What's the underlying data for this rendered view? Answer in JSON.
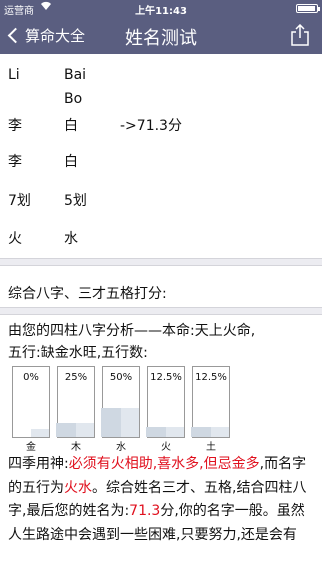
{
  "status": {
    "carrier": "运营商",
    "time": "上午11:43"
  },
  "nav": {
    "back_label": "算命大全",
    "title": "姓名测试"
  },
  "names": {
    "pinyin_first": "Li",
    "pinyin_second_a": "Bai",
    "pinyin_second_b": "Bo",
    "row1_c1": "李",
    "row1_c2": "白",
    "score_text": "->71.3分",
    "row2_c1": "李",
    "row2_c2": "白",
    "strokes_c1": "7划",
    "strokes_c2": "5划",
    "element_c1": "火",
    "element_c2": "水"
  },
  "section_title": "综合八字、三才五格打分:",
  "analysis": {
    "line1": "由您的四柱八字分析——本命:天上火命,",
    "line2": "五行:缺金水旺,五行数:"
  },
  "bars": [
    {
      "element": "金",
      "pct_label": "0%",
      "value": 0
    },
    {
      "element": "木",
      "pct_label": "25%",
      "value": 25
    },
    {
      "element": "水",
      "pct_label": "50%",
      "value": 50
    },
    {
      "element": "火",
      "pct_label": "12.5%",
      "value": 12.5
    },
    {
      "element": "土",
      "pct_label": "12.5%",
      "value": 12.5
    }
  ],
  "paragraph": {
    "p1": "四季用神:",
    "p2": "必须有火相助,喜水多,但忌金多",
    "p3": ",而名字的五行为",
    "p4": "火水",
    "p5": "。综合姓名三才、五格,结合四柱八字,最后您的姓名为:",
    "p6": "71.3",
    "p7": "分,你的名字一般。虽然人生路途中会遇到一些困难,只要努力,还是会有"
  },
  "colors": {
    "nav_bg": "#5a5e80",
    "highlight": "#e0101e"
  }
}
